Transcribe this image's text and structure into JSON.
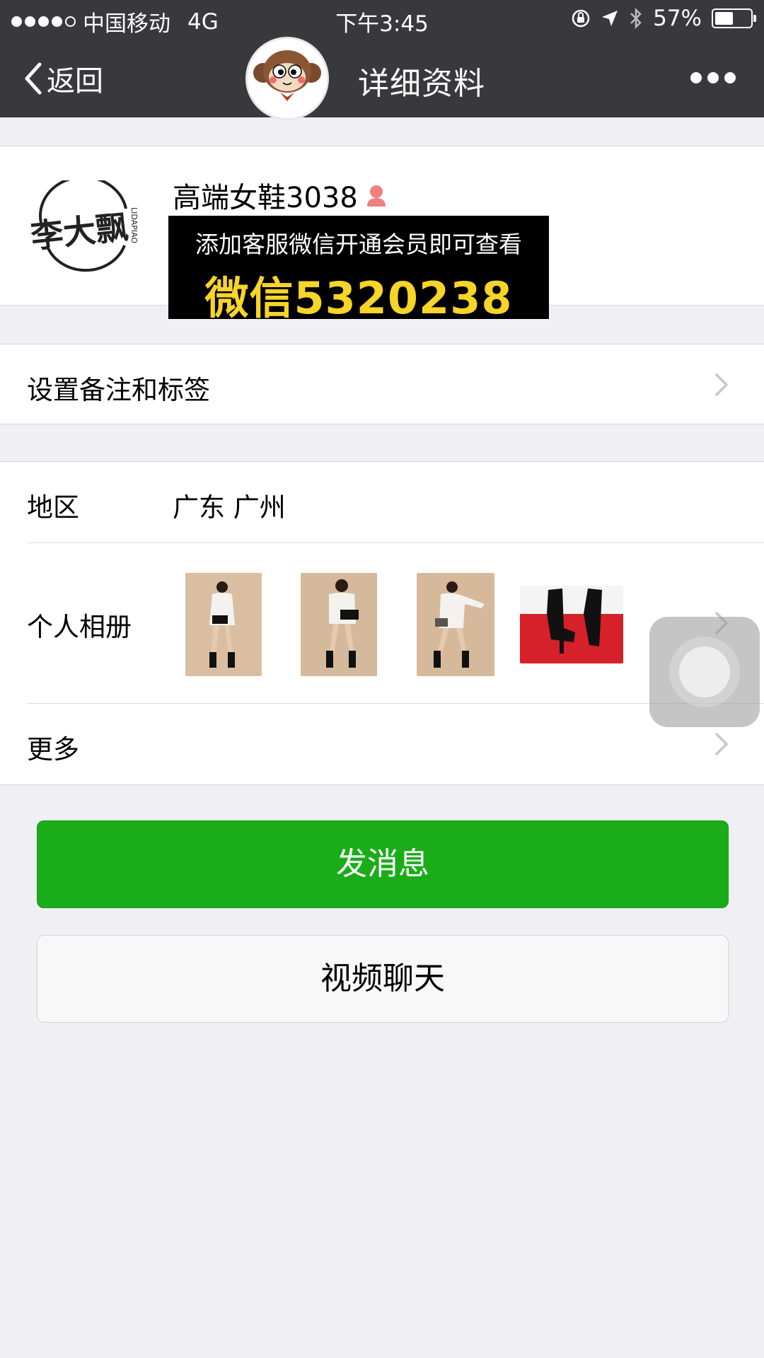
{
  "status_bar": {
    "carrier": "中国移动",
    "network": "4G",
    "time": "下午3:45",
    "battery": "57%",
    "battery_level": 0.57,
    "signal_bars": 4,
    "icons": [
      "rotation-lock-icon",
      "location-arrow-icon",
      "bluetooth-icon",
      "battery-icon"
    ]
  },
  "nav": {
    "back_label": "返回",
    "title": "详细资料",
    "more_icon": "ellipsis-icon"
  },
  "profile": {
    "name": "高端女鞋3038",
    "gender_icon": "female-icon",
    "logo_text": "李大飘",
    "logo_sub": "LIDAPIAO",
    "promo_line1": "添加客服微信开通会员即可查看",
    "promo_line2": "微信5320238"
  },
  "remark": {
    "label": "设置备注和标签"
  },
  "region": {
    "label": "地区",
    "value": "广东 广州"
  },
  "album": {
    "label": "个人相册"
  },
  "more": {
    "label": "更多"
  },
  "actions": {
    "send_message": "发消息",
    "video_chat": "视频聊天"
  },
  "colors": {
    "nav_bg": "#39393d",
    "page_bg": "#efeff4",
    "primary_green": "#1aad19",
    "promo_yellow": "#f6d428"
  }
}
